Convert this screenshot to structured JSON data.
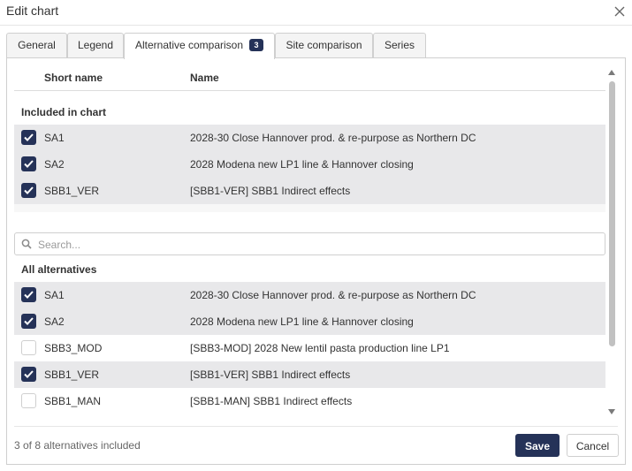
{
  "dialog": {
    "title": "Edit chart"
  },
  "tabs": [
    {
      "label": "General"
    },
    {
      "label": "Legend"
    },
    {
      "label": "Alternative comparison",
      "badge": "3",
      "active": true
    },
    {
      "label": "Site comparison"
    },
    {
      "label": "Series"
    }
  ],
  "columns": {
    "short_name": "Short name",
    "name": "Name"
  },
  "included": {
    "label": "Included in chart",
    "rows": [
      {
        "short": "SA1",
        "name": "2028-30 Close Hannover prod. & re-purpose as Northern DC",
        "checked": true
      },
      {
        "short": "SA2",
        "name": "2028 Modena new LP1 line & Hannover closing",
        "checked": true
      },
      {
        "short": "SBB1_VER",
        "name": "[SBB1-VER] SBB1 Indirect effects",
        "checked": true
      }
    ]
  },
  "search": {
    "placeholder": "Search...",
    "value": ""
  },
  "all": {
    "label": "All alternatives",
    "rows": [
      {
        "short": "SA1",
        "name": "2028-30 Close Hannover prod. & re-purpose as Northern DC",
        "checked": true
      },
      {
        "short": "SA2",
        "name": "2028 Modena new LP1 line & Hannover closing",
        "checked": true
      },
      {
        "short": "SBB3_MOD",
        "name": "[SBB3-MOD] 2028 New lentil pasta production line LP1",
        "checked": false
      },
      {
        "short": "SBB1_VER",
        "name": "[SBB1-VER] SBB1 Indirect effects",
        "checked": true
      },
      {
        "short": "SBB1_MAN",
        "name": "[SBB1-MAN] SBB1 Indirect effects",
        "checked": false
      }
    ]
  },
  "footer": {
    "status": "3 of 8 alternatives included",
    "save_label": "Save",
    "cancel_label": "Cancel"
  },
  "colors": {
    "accent": "#253258",
    "row_checked_bg": "#e8e8ea",
    "border": "#cfcfcf"
  },
  "icons": {
    "close": "close-icon",
    "search": "search-icon",
    "checkbox_checked": "checkmark-icon",
    "scroll_up": "triangle-up-icon",
    "scroll_down": "triangle-down-icon"
  }
}
